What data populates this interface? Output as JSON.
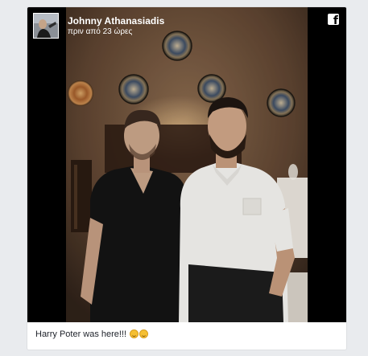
{
  "post": {
    "author": "Johnny Athanasiadis",
    "timestamp": "πριν από 23 ώρες",
    "caption": "Harry Poter was here!!!",
    "emojis": [
      "grinning-face-emoji",
      "smiling-face-emoji"
    ],
    "platform_icon": "facebook-icon"
  },
  "colors": {
    "page_background": "#e9ebee",
    "media_background": "#000000",
    "card_background": "#ffffff",
    "caption_text": "#1d2129"
  }
}
